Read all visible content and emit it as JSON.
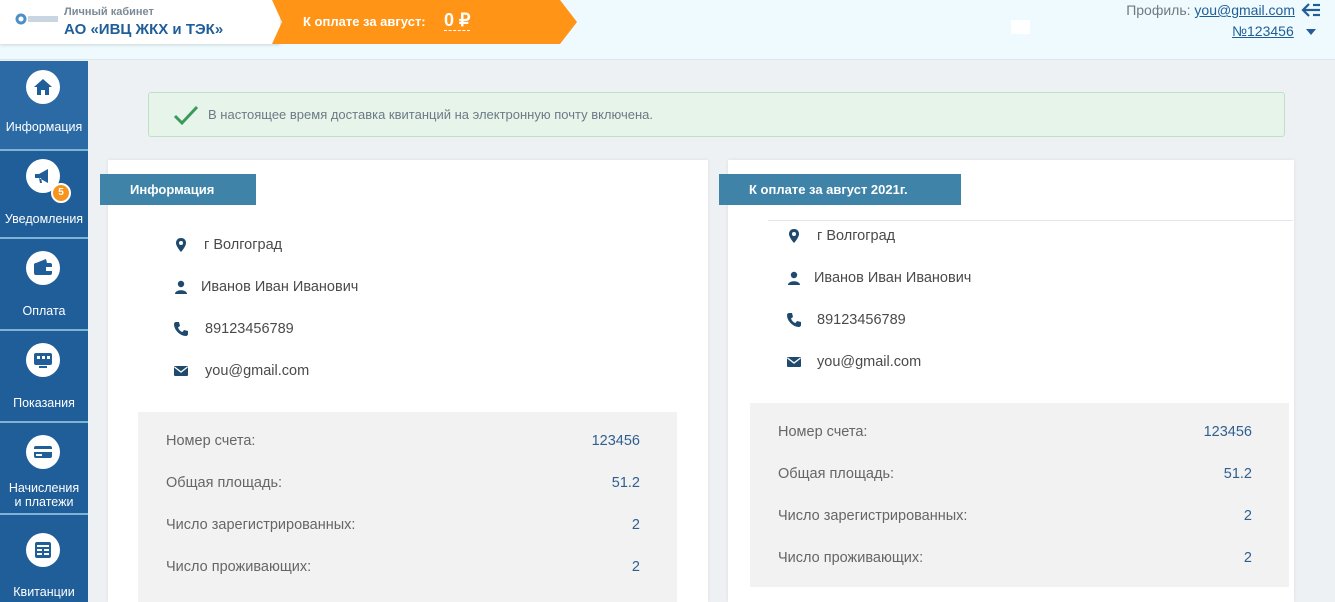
{
  "header": {
    "subtitle": "Личный кабинет",
    "title": "АО «ИВЦ ЖКХ и ТЭК»",
    "logo_text": "ИВЦ ЖКХ и ТЭК",
    "payment_label": "К оплате за август:",
    "payment_value": "0 ₽",
    "profile_label": "Профиль:",
    "profile_email": "you@gmail.com",
    "account_number": "№123456"
  },
  "sidebar": {
    "items": [
      {
        "label": "Информация",
        "icon": "home-icon",
        "active": true
      },
      {
        "label": "Уведомления",
        "icon": "megaphone-icon",
        "badge": "5"
      },
      {
        "label": "Оплата",
        "icon": "wallet-icon"
      },
      {
        "label": "Показания",
        "icon": "meter-icon"
      },
      {
        "label": "Начисления",
        "label2": "и платежи",
        "icon": "card-icon"
      },
      {
        "label": "Квитанции",
        "icon": "receipt-icon"
      }
    ]
  },
  "alert": {
    "text": "В настоящее время доставка квитанций на электронную почту включена."
  },
  "info_card": {
    "tab": "Информация",
    "city": "г Волгоград",
    "name": "Иванов Иван Иванович",
    "phone": "89123456789",
    "email": "you@gmail.com",
    "stats": [
      {
        "label": "Номер счета:",
        "value": "123456"
      },
      {
        "label": "Общая площадь:",
        "value": "51.2"
      },
      {
        "label": "Число зарегистрированных:",
        "value": "2"
      },
      {
        "label": "Число проживающих:",
        "value": "2"
      }
    ]
  },
  "payment_card": {
    "tab": "К оплате за август 2021г.",
    "city": "г Волгоград",
    "name": "Иванов Иван Иванович",
    "phone": "89123456789",
    "email": "you@gmail.com",
    "stats": [
      {
        "label": "Номер счета:",
        "value": "123456"
      },
      {
        "label": "Общая площадь:",
        "value": "51.2"
      },
      {
        "label": "Число зарегистрированных:",
        "value": "2"
      },
      {
        "label": "Число проживающих:",
        "value": "2"
      }
    ]
  },
  "colors": {
    "primary": "#1f5e98",
    "accent": "#ff9416",
    "tab": "#3f83a8",
    "success": "#2e8b57"
  }
}
